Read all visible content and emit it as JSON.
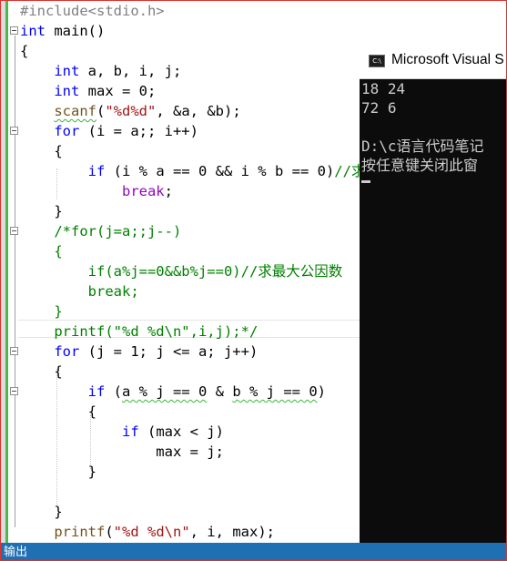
{
  "editor": {
    "lines": [
      [
        {
          "t": "#include<stdio.h>",
          "c": "pp"
        }
      ],
      [
        {
          "t": "int",
          "c": "kw"
        },
        {
          "t": " main()"
        }
      ],
      [
        {
          "t": "{"
        }
      ],
      [
        {
          "t": "    "
        },
        {
          "t": "int",
          "c": "kw"
        },
        {
          "t": " a, b, i, j;"
        }
      ],
      [
        {
          "t": "    "
        },
        {
          "t": "int",
          "c": "kw"
        },
        {
          "t": " max = 0;"
        }
      ],
      [
        {
          "t": "    "
        },
        {
          "t": "scanf",
          "c": "fn squig"
        },
        {
          "t": "("
        },
        {
          "t": "\"%d%d\"",
          "c": "str"
        },
        {
          "t": ", &a, &b);"
        }
      ],
      [
        {
          "t": "    "
        },
        {
          "t": "for",
          "c": "kw"
        },
        {
          "t": " (i = a;; i++)"
        }
      ],
      [
        {
          "t": "    {"
        }
      ],
      [
        {
          "t": "        "
        },
        {
          "t": "if",
          "c": "kw"
        },
        {
          "t": " (i % a == 0 && i % b == 0)"
        },
        {
          "t": "//求",
          "c": "cmt"
        }
      ],
      [
        {
          "t": "            "
        },
        {
          "t": "break",
          "c": "purple"
        },
        {
          "t": ";"
        }
      ],
      [
        {
          "t": "    }"
        }
      ],
      [
        {
          "t": "    "
        },
        {
          "t": "/*for(j=a;;j--)",
          "c": "cmt"
        }
      ],
      [
        {
          "t": "    {",
          "c": "cmt"
        }
      ],
      [
        {
          "t": "        if(a%j==0&&b%j==0)//求最大公因数",
          "c": "cmt"
        }
      ],
      [
        {
          "t": "        break;",
          "c": "cmt"
        }
      ],
      [
        {
          "t": "    }",
          "c": "cmt"
        }
      ],
      [
        {
          "t": "    printf(\"%d %d\\n\",i,j);*/",
          "c": "cmt"
        }
      ],
      [
        {
          "t": "    "
        },
        {
          "t": "for",
          "c": "kw"
        },
        {
          "t": " (j = 1; j <= a; j++)"
        }
      ],
      [
        {
          "t": "    {"
        }
      ],
      [
        {
          "t": "        "
        },
        {
          "t": "if",
          "c": "kw"
        },
        {
          "t": " ("
        },
        {
          "t": "a % j == 0",
          "c": "squig"
        },
        {
          "t": " & "
        },
        {
          "t": "b % j == 0",
          "c": "squig"
        },
        {
          "t": ")"
        }
      ],
      [
        {
          "t": "        {"
        }
      ],
      [
        {
          "t": "            "
        },
        {
          "t": "if",
          "c": "kw"
        },
        {
          "t": " (max < j)"
        }
      ],
      [
        {
          "t": "                max = j;"
        }
      ],
      [
        {
          "t": "        }"
        }
      ],
      [
        {
          "t": ""
        }
      ],
      [
        {
          "t": "    }"
        }
      ],
      [
        {
          "t": "    "
        },
        {
          "t": "printf",
          "c": "fn"
        },
        {
          "t": "("
        },
        {
          "t": "\"%d %d\\n\"",
          "c": "str"
        },
        {
          "t": ", i, max);"
        }
      ]
    ]
  },
  "console": {
    "title": "Microsoft Visual S",
    "icon_label": "C:\\",
    "icon": "console-app-icon",
    "lines": [
      "18 24",
      "72 6",
      "",
      "D:\\c语言代码笔记",
      "按任意键关闭此窗"
    ]
  },
  "output_panel": {
    "label": "输出"
  },
  "colors": {
    "keyword": "#0000ff",
    "string": "#a31515",
    "comment": "#008000",
    "preprocessor": "#808080",
    "function": "#74531f",
    "control": "#8f08c4",
    "console_bg": "#0c0c0c",
    "output_bar": "#1f6fb3"
  }
}
